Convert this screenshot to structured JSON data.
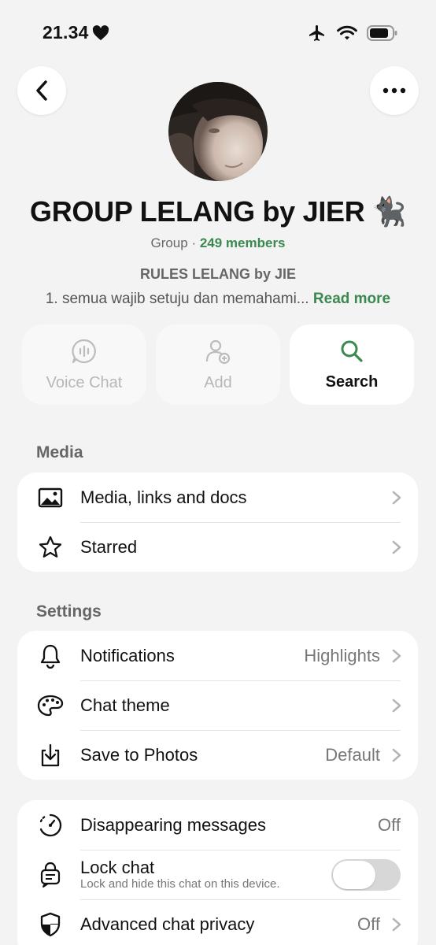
{
  "status_bar": {
    "time": "21.34"
  },
  "group": {
    "name": "GROUP LELANG by JIER",
    "emoji": "🐈‍⬛",
    "type_label": "Group",
    "separator": " · ",
    "members": "249 members",
    "description_title": "RULES LELANG by JIE",
    "description_preview": "1. semua wajib setuju dan memahami...",
    "read_more": "Read more"
  },
  "actions": [
    {
      "label": "Voice Chat",
      "icon": "voice-chat-icon",
      "enabled": false
    },
    {
      "label": "Add",
      "icon": "add-person-icon",
      "enabled": false
    },
    {
      "label": "Search",
      "icon": "search-icon",
      "enabled": true
    }
  ],
  "media_section": {
    "title": "Media",
    "items": [
      {
        "label": "Media, links and docs",
        "icon": "image-icon"
      },
      {
        "label": "Starred",
        "icon": "star-icon"
      }
    ]
  },
  "settings_section": {
    "title": "Settings",
    "items": [
      {
        "label": "Notifications",
        "value": "Highlights",
        "icon": "bell-icon"
      },
      {
        "label": "Chat theme",
        "icon": "palette-icon"
      },
      {
        "label": "Save to Photos",
        "value": "Default",
        "icon": "download-icon"
      }
    ]
  },
  "privacy_section": {
    "items": [
      {
        "label": "Disappearing messages",
        "value": "Off",
        "icon": "timer-icon"
      },
      {
        "label": "Lock chat",
        "sublabel": "Lock and hide this chat on this device.",
        "icon": "lock-chat-icon",
        "toggle": false
      },
      {
        "label": "Advanced chat privacy",
        "value": "Off",
        "icon": "shield-icon"
      }
    ]
  },
  "colors": {
    "accent": "#3a8a4f",
    "background": "#f3f3f3",
    "card": "#ffffff"
  }
}
